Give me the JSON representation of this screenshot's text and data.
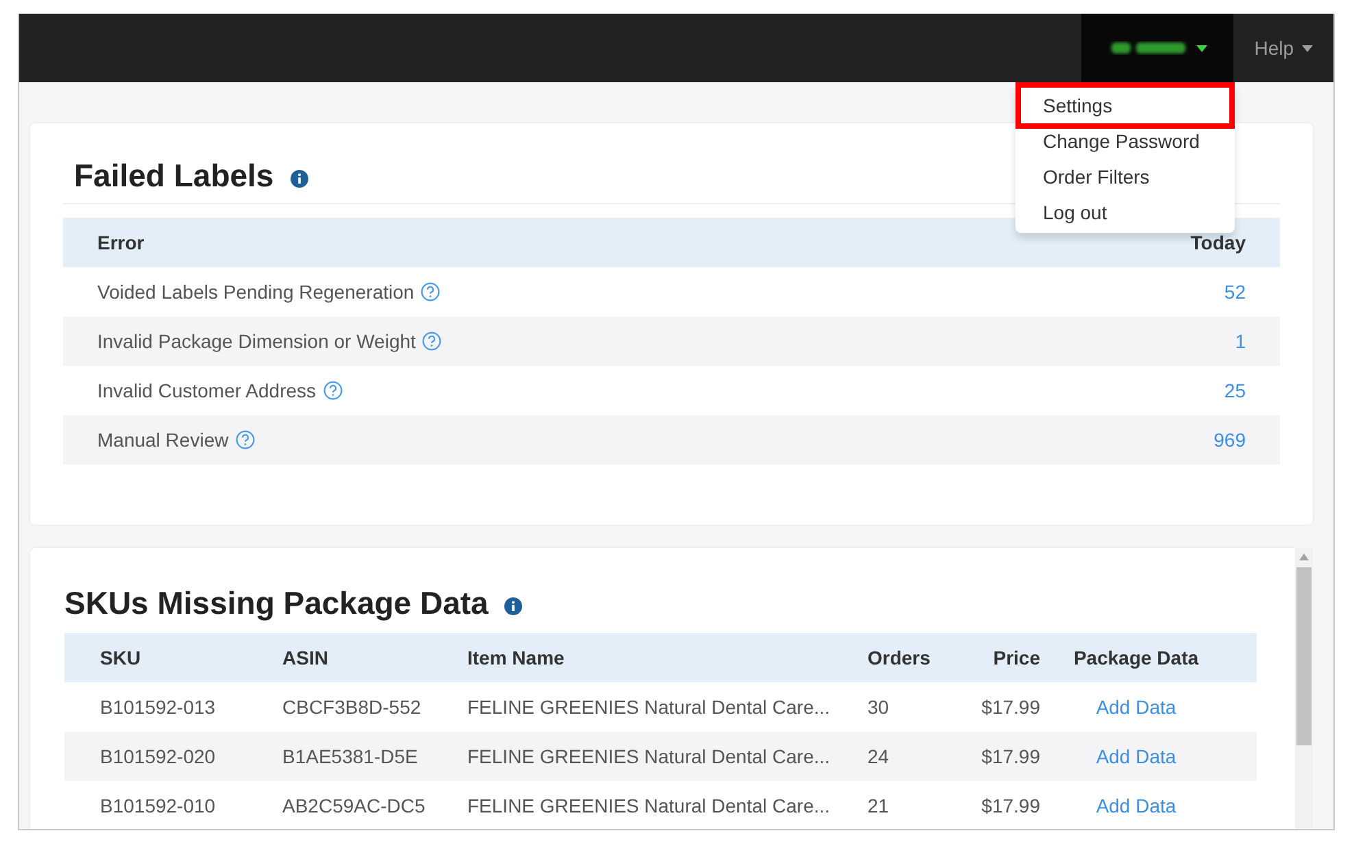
{
  "navbar": {
    "user_menu": {
      "expanded": true
    },
    "help_menu": {
      "label": "Help"
    }
  },
  "user_dropdown": {
    "items": [
      {
        "label": "Settings",
        "highlighted": true
      },
      {
        "label": "Change Password",
        "highlighted": false
      },
      {
        "label": "Order Filters",
        "highlighted": false
      },
      {
        "label": "Log out",
        "highlighted": false
      }
    ]
  },
  "failed_labels": {
    "title": "Failed Labels",
    "columns": [
      "Error",
      "Today"
    ],
    "rows": [
      {
        "error": "Voided Labels Pending Regeneration",
        "today": "52"
      },
      {
        "error": "Invalid Package Dimension or Weight",
        "today": "1"
      },
      {
        "error": "Invalid Customer Address",
        "today": "25"
      },
      {
        "error": "Manual Review",
        "today": "969"
      }
    ]
  },
  "skus_missing": {
    "title": "SKUs Missing Package Data",
    "columns": [
      "SKU",
      "ASIN",
      "Item Name",
      "Orders",
      "Price",
      "Package Data"
    ],
    "rows": [
      {
        "sku": "B101592-013",
        "asin": "CBCF3B8D-552",
        "item_name": "FELINE GREENIES Natural Dental Care...",
        "orders": "30",
        "price": "$17.99",
        "action": "Add Data"
      },
      {
        "sku": "B101592-020",
        "asin": "B1AE5381-D5E",
        "item_name": "FELINE GREENIES Natural Dental Care...",
        "orders": "24",
        "price": "$17.99",
        "action": "Add Data"
      },
      {
        "sku": "B101592-010",
        "asin": "AB2C59AC-DC5",
        "item_name": "FELINE GREENIES Natural Dental Care...",
        "orders": "21",
        "price": "$17.99",
        "action": "Add Data"
      }
    ]
  }
}
